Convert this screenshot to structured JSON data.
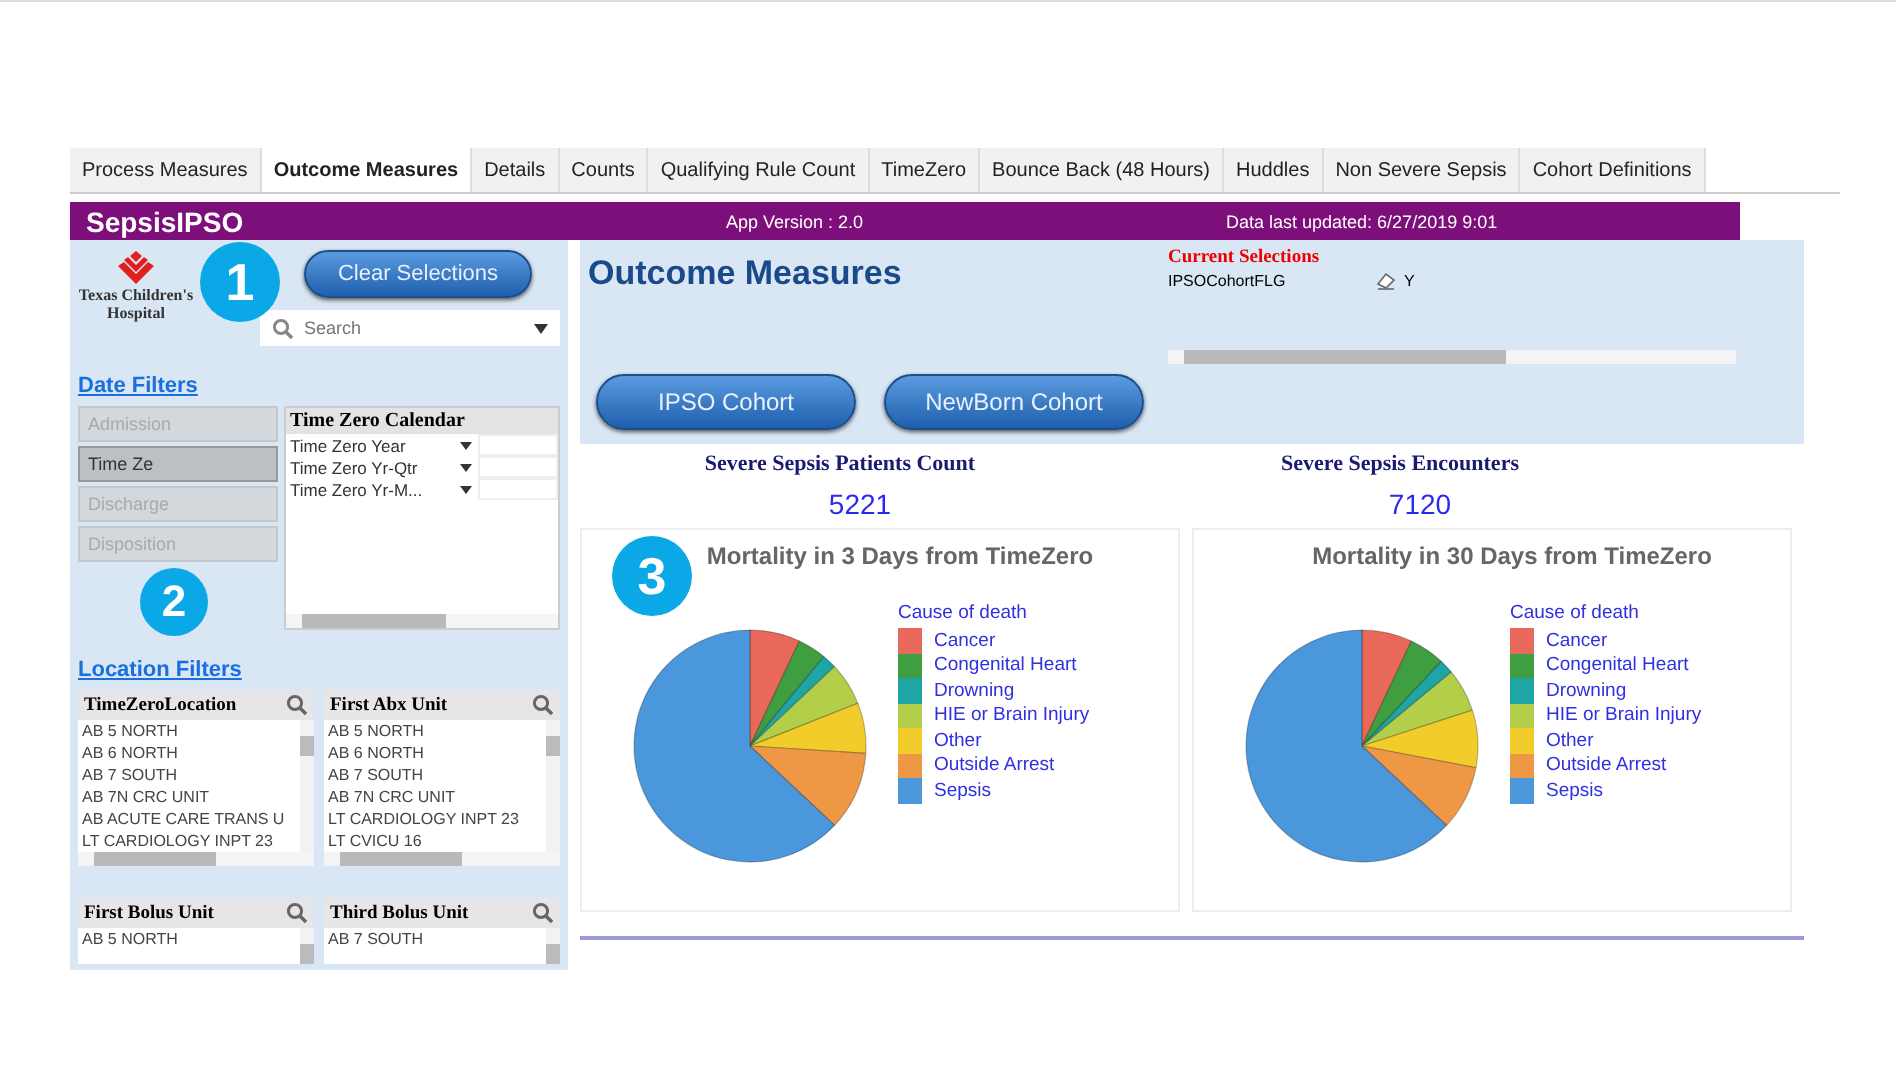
{
  "tabs": [
    {
      "label": "Process Measures",
      "selected": false
    },
    {
      "label": "Outcome Measures",
      "selected": true
    },
    {
      "label": "Details",
      "selected": false
    },
    {
      "label": "Counts",
      "selected": false
    },
    {
      "label": "Qualifying Rule Count",
      "selected": false
    },
    {
      "label": "TimeZero",
      "selected": false
    },
    {
      "label": "Bounce Back (48 Hours)",
      "selected": false
    },
    {
      "label": "Huddles",
      "selected": false
    },
    {
      "label": "Non Severe Sepsis",
      "selected": false
    },
    {
      "label": "Cohort Definitions",
      "selected": false
    }
  ],
  "header": {
    "title": "SepsisIPSO",
    "version": "App Version : 2.0",
    "updated": "Data last updated:  6/27/2019 9:01"
  },
  "sidebar": {
    "logo_lines": [
      "Texas Children's",
      "Hospital"
    ],
    "clear_button": "Clear Selections",
    "search": {
      "placeholder": "Search"
    },
    "date_filters": "Date Filters",
    "date_tabs": [
      {
        "label": "Admission",
        "selected": false
      },
      {
        "label": "Time Ze",
        "selected": true
      },
      {
        "label": "Discharge",
        "selected": false
      },
      {
        "label": "Disposition",
        "selected": false
      }
    ],
    "calendar": {
      "title": "Time Zero Calendar",
      "fields": [
        {
          "label": "Time Zero Year"
        },
        {
          "label": "Time Zero Yr-Qtr"
        },
        {
          "label": "Time Zero Yr-M..."
        }
      ]
    },
    "location_filters": "Location Filters",
    "list_boxes": [
      {
        "title": "TimeZeroLocation",
        "items": [
          "AB 5 NORTH",
          "AB 6 NORTH",
          "AB 7 SOUTH",
          "AB 7N CRC UNIT",
          "AB ACUTE CARE TRANS U",
          "LT CARDIOLOGY INPT 23"
        ]
      },
      {
        "title": "First Abx Unit",
        "items": [
          "AB 5 NORTH",
          "AB 6 NORTH",
          "AB 7 SOUTH",
          "AB 7N CRC UNIT",
          "LT CARDIOLOGY INPT 23",
          "LT CVICU 16"
        ]
      },
      {
        "title": "First Bolus Unit",
        "items": [
          "AB 5 NORTH"
        ]
      },
      {
        "title": "Third Bolus Unit",
        "items": [
          "AB 7 SOUTH"
        ]
      }
    ]
  },
  "main": {
    "title": "Outcome Measures",
    "current_selections": {
      "heading": "Current Selections",
      "field": "IPSOCohortFLG",
      "value": "Y"
    },
    "cohort_buttons": [
      "IPSO Cohort",
      "NewBorn Cohort"
    ],
    "kpis": [
      {
        "label": "Severe Sepsis Patients Count",
        "value": "5221"
      },
      {
        "label": "Severe Sepsis Encounters",
        "value": "7120"
      }
    ],
    "charts": [
      {
        "title": "Mortality in 3 Days from TimeZero",
        "legend_title": "Cause of death",
        "legend": [
          {
            "label": "Cancer",
            "color": "#e8685a"
          },
          {
            "label": "Congenital Heart",
            "color": "#3f9e3f"
          },
          {
            "label": "Drowning",
            "color": "#1fa5a5"
          },
          {
            "label": "HIE or Brain Injury",
            "color": "#b3cf4a"
          },
          {
            "label": "Other",
            "color": "#f2cc2a"
          },
          {
            "label": "Outside Arrest",
            "color": "#ee9845"
          },
          {
            "label": "Sepsis",
            "color": "#4a97db"
          }
        ]
      },
      {
        "title": "Mortality in 30 Days from TimeZero",
        "legend_title": "Cause of death",
        "legend": [
          {
            "label": "Cancer",
            "color": "#e8685a"
          },
          {
            "label": "Congenital Heart",
            "color": "#3f9e3f"
          },
          {
            "label": "Drowning",
            "color": "#1fa5a5"
          },
          {
            "label": "HIE or Brain Injury",
            "color": "#b3cf4a"
          },
          {
            "label": "Other",
            "color": "#f2cc2a"
          },
          {
            "label": "Outside Arrest",
            "color": "#ee9845"
          },
          {
            "label": "Sepsis",
            "color": "#4a97db"
          }
        ]
      }
    ]
  },
  "callouts": [
    "1",
    "2",
    "3"
  ]
}
